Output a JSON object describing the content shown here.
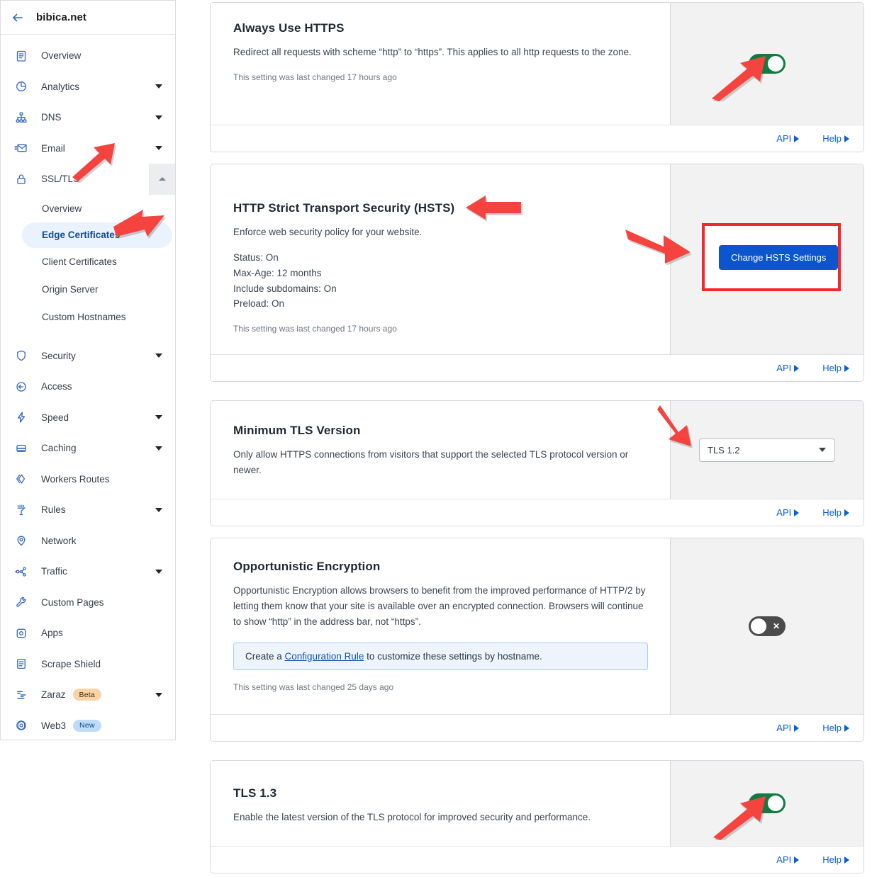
{
  "sidebar": {
    "back_icon": "back-arrow-icon",
    "zone_name": "bibica.net",
    "items": [
      {
        "label": "Overview",
        "icon": "clipboard-icon",
        "expandable": false
      },
      {
        "label": "Analytics",
        "icon": "pie-chart-icon",
        "expandable": true
      },
      {
        "label": "DNS",
        "icon": "sitemap-icon",
        "expandable": true
      },
      {
        "label": "Email",
        "icon": "envelope-icon",
        "expandable": true
      },
      {
        "label": "SSL/TLS",
        "icon": "lock-icon",
        "expandable": false,
        "expanded": true
      }
    ],
    "ssl_children": [
      {
        "label": "Overview",
        "active": false
      },
      {
        "label": "Edge Certificates",
        "active": true
      },
      {
        "label": "Client Certificates",
        "active": false
      },
      {
        "label": "Origin Server",
        "active": false
      },
      {
        "label": "Custom Hostnames",
        "active": false
      }
    ],
    "items_lower": [
      {
        "label": "Security",
        "icon": "shield-icon",
        "expandable": true
      },
      {
        "label": "Access",
        "icon": "access-icon",
        "expandable": false
      },
      {
        "label": "Speed",
        "icon": "bolt-icon",
        "expandable": true
      },
      {
        "label": "Caching",
        "icon": "database-icon",
        "expandable": true
      },
      {
        "label": "Workers Routes",
        "icon": "workers-icon",
        "expandable": false
      },
      {
        "label": "Rules",
        "icon": "rules-icon",
        "expandable": true
      },
      {
        "label": "Network",
        "icon": "location-pin-icon",
        "expandable": false
      },
      {
        "label": "Traffic",
        "icon": "traffic-icon",
        "expandable": true
      },
      {
        "label": "Custom Pages",
        "icon": "wrench-icon",
        "expandable": false
      },
      {
        "label": "Apps",
        "icon": "apps-icon",
        "expandable": false
      },
      {
        "label": "Scrape Shield",
        "icon": "document-icon",
        "expandable": false
      },
      {
        "label": "Zaraz",
        "icon": "zaraz-icon",
        "expandable": true,
        "badge": "Beta",
        "badge_kind": "beta"
      },
      {
        "label": "Web3",
        "icon": "web3-icon",
        "expandable": false,
        "badge": "New",
        "badge_kind": "new"
      }
    ]
  },
  "cards": {
    "always_https": {
      "title": "Always Use HTTPS",
      "desc": "Redirect all requests with scheme “http” to “https”. This applies to all http requests to the zone.",
      "changed": "This setting was last changed 17 hours ago",
      "toggle_state": "on",
      "toggle_mark": "✓",
      "api_label": "API",
      "help_label": "Help"
    },
    "hsts": {
      "title": "HTTP Strict Transport Security (HSTS)",
      "desc": "Enforce web security policy for your website.",
      "stats": [
        "Status: On",
        "Max-Age: 12 months",
        "Include subdomains: On",
        "Preload: On"
      ],
      "changed": "This setting was last changed 17 hours ago",
      "button_label": "Change HSTS Settings",
      "api_label": "API",
      "help_label": "Help"
    },
    "min_tls": {
      "title": "Minimum TLS Version",
      "desc": "Only allow HTTPS connections from visitors that support the selected TLS protocol version or newer.",
      "selected_value": "TLS 1.2",
      "api_label": "API",
      "help_label": "Help"
    },
    "opportunistic": {
      "title": "Opportunistic Encryption",
      "desc": "Opportunistic Encryption allows browsers to benefit from the improved performance of HTTP/2 by letting them know that your site is available over an encrypted connection. Browsers will continue to show “http” in the address bar, not “https”.",
      "banner_prefix": "Create a ",
      "banner_link": "Configuration Rule",
      "banner_suffix": " to customize these settings by hostname.",
      "changed": "This setting was last changed 25 days ago",
      "toggle_state": "off",
      "toggle_mark": "✕",
      "api_label": "API",
      "help_label": "Help"
    },
    "tls13": {
      "title": "TLS 1.3",
      "desc": "Enable the latest version of the TLS protocol for improved security and performance.",
      "toggle_state": "on",
      "toggle_mark": "✓",
      "api_label": "API",
      "help_label": "Help"
    }
  },
  "annotations": {
    "arrow_color": "#f5443f",
    "highlight_color": "#f5272c",
    "count": 6
  }
}
